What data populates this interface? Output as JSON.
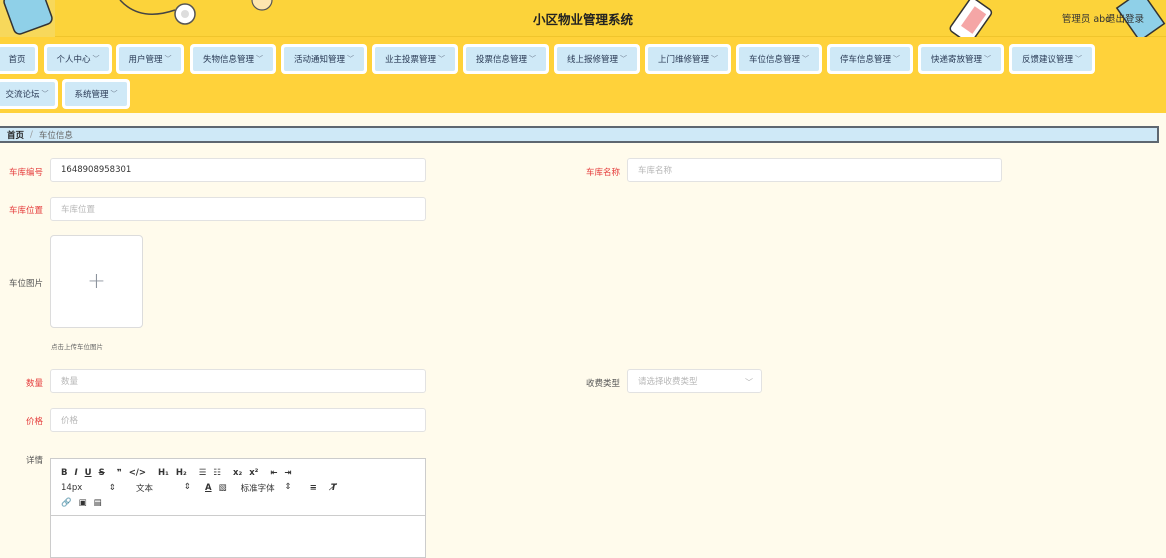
{
  "header": {
    "title": "小区物业管理系统",
    "user": "管理员 abo",
    "logout": "退出登录"
  },
  "nav": {
    "row1": [
      {
        "label": "首页",
        "dropdown": false
      },
      {
        "label": "个人中心",
        "dropdown": true
      },
      {
        "label": "用户管理",
        "dropdown": true
      },
      {
        "label": "失物信息管理",
        "dropdown": true
      },
      {
        "label": "活动通知管理",
        "dropdown": true
      },
      {
        "label": "业主投票管理",
        "dropdown": true
      },
      {
        "label": "投票信息管理",
        "dropdown": true
      },
      {
        "label": "线上报修管理",
        "dropdown": true
      },
      {
        "label": "上门维修管理",
        "dropdown": true
      },
      {
        "label": "车位信息管理",
        "dropdown": true
      },
      {
        "label": "停车信息管理",
        "dropdown": true
      },
      {
        "label": "快递寄放管理",
        "dropdown": true
      },
      {
        "label": "反馈建议管理",
        "dropdown": true
      }
    ],
    "row2": [
      {
        "label": "交流论坛",
        "dropdown": true
      },
      {
        "label": "系统管理",
        "dropdown": true
      }
    ]
  },
  "breadcrumb": {
    "home": "首页",
    "separator": "/",
    "current": "车位信息"
  },
  "form": {
    "garage_no": {
      "label": "车库编号",
      "value": "1648908958301"
    },
    "garage_name": {
      "label": "车库名称",
      "placeholder": "车库名称"
    },
    "garage_location": {
      "label": "车库位置",
      "placeholder": "车库位置"
    },
    "image": {
      "label": "车位图片",
      "plus": "+",
      "hint": "点击上传车位图片"
    },
    "quantity": {
      "label": "数量",
      "placeholder": "数量"
    },
    "fee_type": {
      "label": "收费类型",
      "placeholder": "请选择收费类型"
    },
    "price": {
      "label": "价格",
      "placeholder": "价格"
    },
    "details": {
      "label": "详情"
    }
  },
  "editor": {
    "row1": [
      "B",
      "I",
      "U",
      "S",
      "❞",
      "</>",
      "H₁",
      "H₂",
      "☰",
      "☷",
      "x₂",
      "x²",
      "⇤",
      "⇥"
    ],
    "font_size": "14px",
    "text_type": "文本",
    "font_family": "标准字体",
    "row3": [
      "🔗",
      "▣",
      "▤"
    ]
  },
  "colors": {
    "header_bg": "#ffd23a",
    "nav_item_bg": "#cfe9f7",
    "page_bg": "#fffbec",
    "required": "#e53b3b"
  }
}
